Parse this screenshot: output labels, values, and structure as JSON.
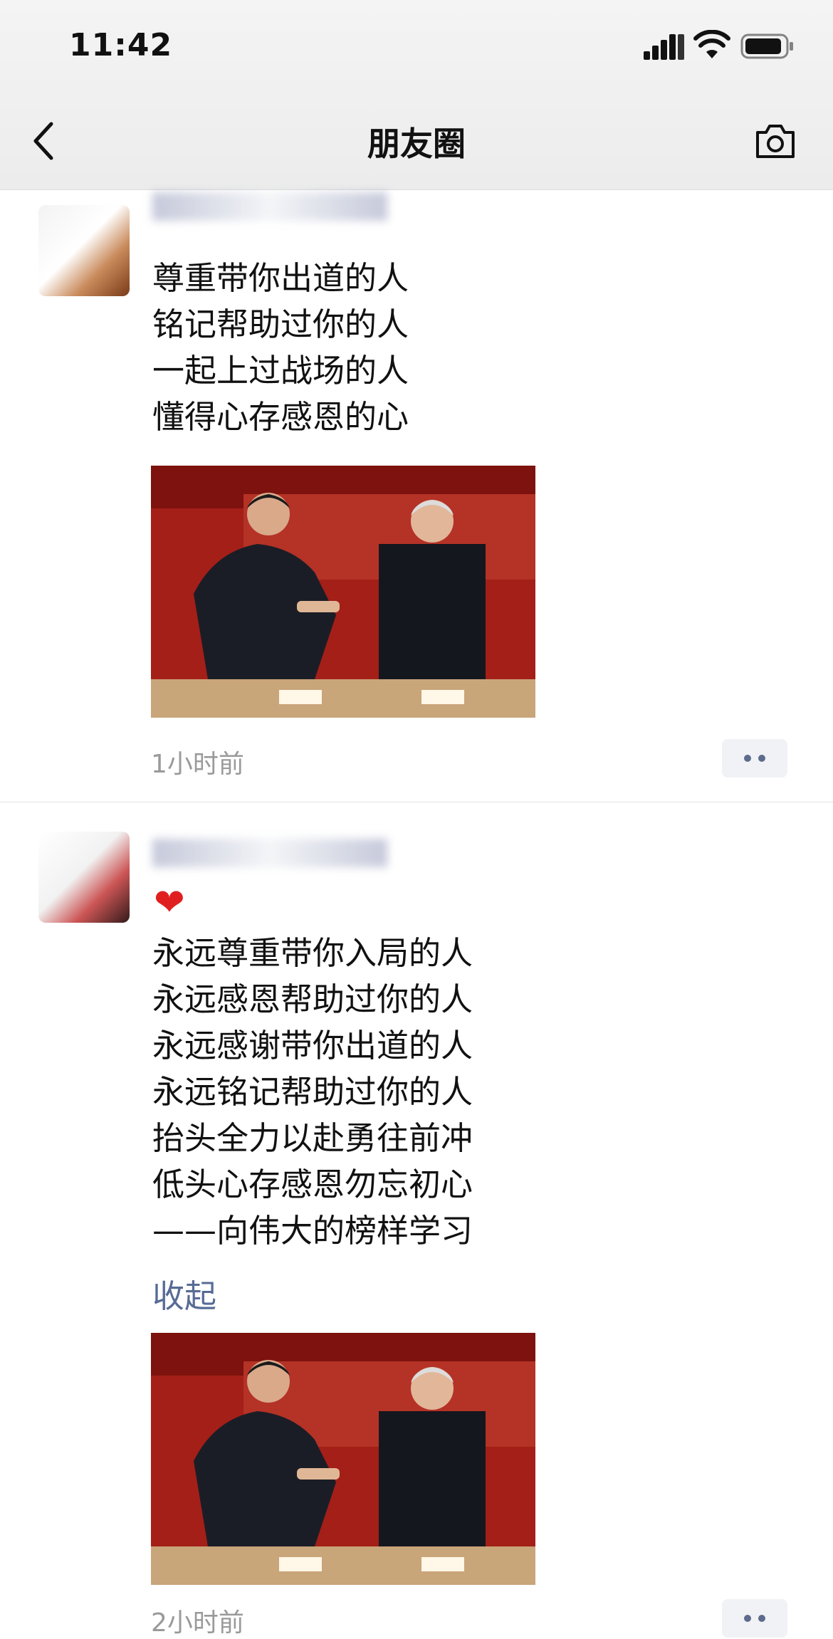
{
  "status_bar": {
    "time": "11:42"
  },
  "nav": {
    "title": "朋友圈",
    "back_icon": "back-chevron-icon",
    "camera_icon": "camera-icon"
  },
  "colors": {
    "link": "#576b95",
    "heart": "#e02020",
    "meta": "#9a9a9a"
  },
  "posts": [
    {
      "lines": [
        "尊重带你出道的人",
        "铭记帮助过你的人",
        "一起上过战场的人",
        "懂得心存感恩的心"
      ],
      "time": "1小时前"
    },
    {
      "emoji": "❤",
      "lines": [
        "永远尊重带你入局的人",
        "永远感恩帮助过你的人",
        "永远感谢带你出道的人",
        "永远铭记帮助过你的人",
        "抬头全力以赴勇往前冲",
        "低头心存感恩勿忘初心",
        "——向伟大的榜样学习"
      ],
      "collapse": "收起",
      "time": "2小时前"
    }
  ]
}
